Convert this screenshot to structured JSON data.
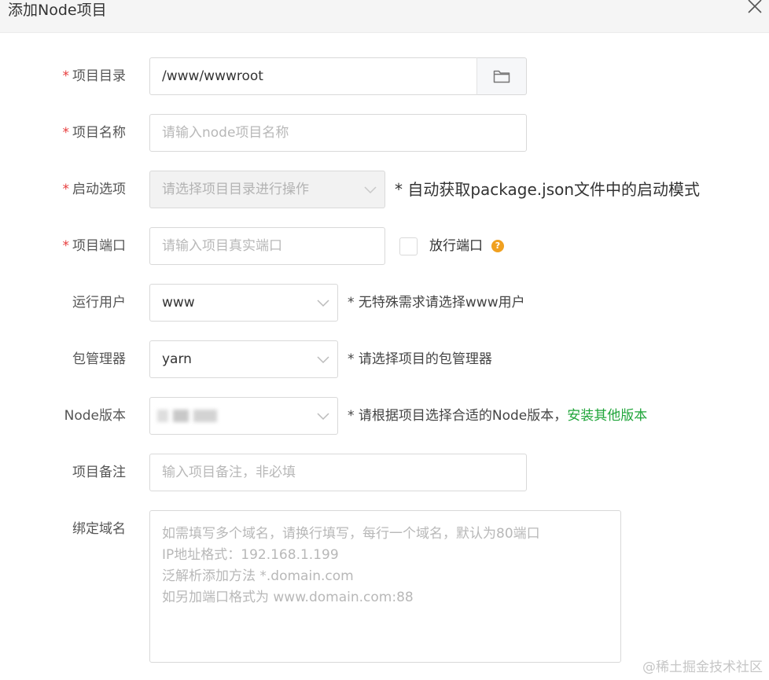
{
  "dialog": {
    "title": "添加Node项目",
    "close_icon": "close-icon"
  },
  "form": {
    "project_dir": {
      "label": "项目目录",
      "required": true,
      "value": "/www/wwwroot",
      "folder_icon": "folder-icon"
    },
    "project_name": {
      "label": "项目名称",
      "required": true,
      "placeholder": "请输入node项目名称"
    },
    "start_option": {
      "label": "启动选项",
      "required": true,
      "placeholder": "请选择项目目录进行操作",
      "disabled": true,
      "hint": "* 自动获取package.json文件中的启动模式"
    },
    "project_port": {
      "label": "项目端口",
      "required": true,
      "placeholder": "请输入项目真实端口",
      "open_port_label": "放行端口",
      "open_port_checked": false,
      "help_icon": "help-icon",
      "help_icon_glyph": "?"
    },
    "run_user": {
      "label": "运行用户",
      "value": "www",
      "hint": "* 无特殊需求请选择www用户"
    },
    "package_manager": {
      "label": "包管理器",
      "value": "yarn",
      "hint": "* 请选择项目的包管理器"
    },
    "node_version": {
      "label": "Node版本",
      "hint": "* 请根据项目选择合适的Node版本，",
      "link": "安装其他版本"
    },
    "remark": {
      "label": "项目备注",
      "placeholder": "输入项目备注，非必填"
    },
    "domain": {
      "label": "绑定域名",
      "placeholder_lines": [
        "如需填写多个域名，请换行填写，每行一个域名，默认为80端口",
        "IP地址格式：192.168.1.199",
        "泛解析添加方法 *.domain.com",
        "如另加端口格式为 www.domain.com:88"
      ]
    }
  },
  "watermark": "@稀土掘金技术社区",
  "colors": {
    "required": "#e73c3c",
    "link": "#20a53a",
    "help": "#f0a020"
  }
}
